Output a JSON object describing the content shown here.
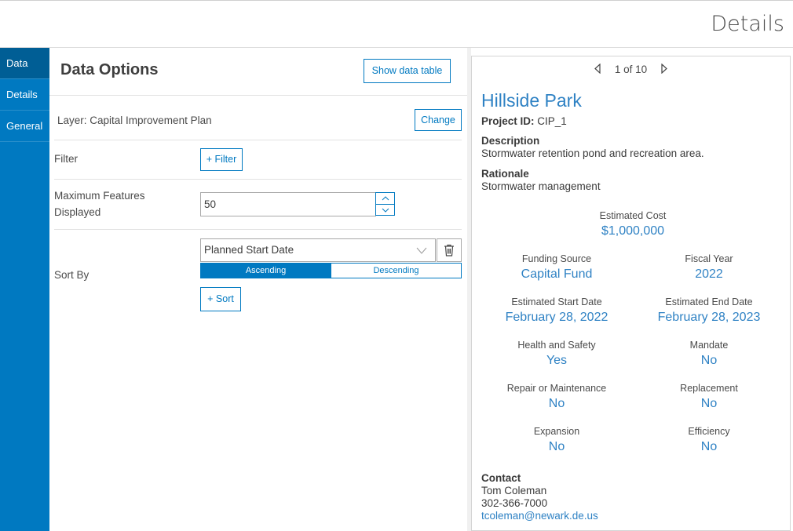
{
  "header": {
    "title": "Details"
  },
  "sidebar": {
    "items": [
      {
        "label": "Data"
      },
      {
        "label": "Details"
      },
      {
        "label": "General"
      }
    ]
  },
  "panel": {
    "title": "Data Options",
    "show_table_label": "Show data table",
    "layer_label": "Layer: Capital Improvement Plan",
    "change_label": "Change",
    "filter_label": "Filter",
    "add_filter_label": "+ Filter",
    "max_features_label_1": "Maximum Features",
    "max_features_label_2": "Displayed",
    "max_features_value": "50",
    "sort_by_label": "Sort By",
    "sort_field": "Planned Start Date",
    "ascending_label": "Ascending",
    "descending_label": "Descending",
    "add_sort_label": "+ Sort"
  },
  "details": {
    "pager": "1 of 10",
    "feature_title": "Hillside Park",
    "project_id_label": "Project ID:",
    "project_id_value": "CIP_1",
    "description_label": "Description",
    "description_value": "Stormwater retention pond and recreation area.",
    "rationale_label": "Rationale",
    "rationale_value": "Stormwater management",
    "estimated_cost_label": "Estimated Cost",
    "estimated_cost_value": "$1,000,000",
    "stats": [
      {
        "label": "Funding Source",
        "value": "Capital Fund"
      },
      {
        "label": "Fiscal Year",
        "value": "2022"
      },
      {
        "label": "Estimated Start Date",
        "value": "February 28, 2022"
      },
      {
        "label": "Estimated End Date",
        "value": "February 28, 2023"
      },
      {
        "label": "Health and Safety",
        "value": "Yes"
      },
      {
        "label": "Mandate",
        "value": "No"
      },
      {
        "label": "Repair or Maintenance",
        "value": "No"
      },
      {
        "label": "Replacement",
        "value": "No"
      },
      {
        "label": "Expansion",
        "value": "No"
      },
      {
        "label": "Efficiency",
        "value": "No"
      }
    ],
    "contact_label": "Contact",
    "contact_name": "Tom Coleman",
    "contact_phone": "302-366-7000",
    "contact_email": "tcoleman@newark.de.us"
  },
  "colors": {
    "accent": "#0079c1",
    "link": "#2f82c4"
  }
}
